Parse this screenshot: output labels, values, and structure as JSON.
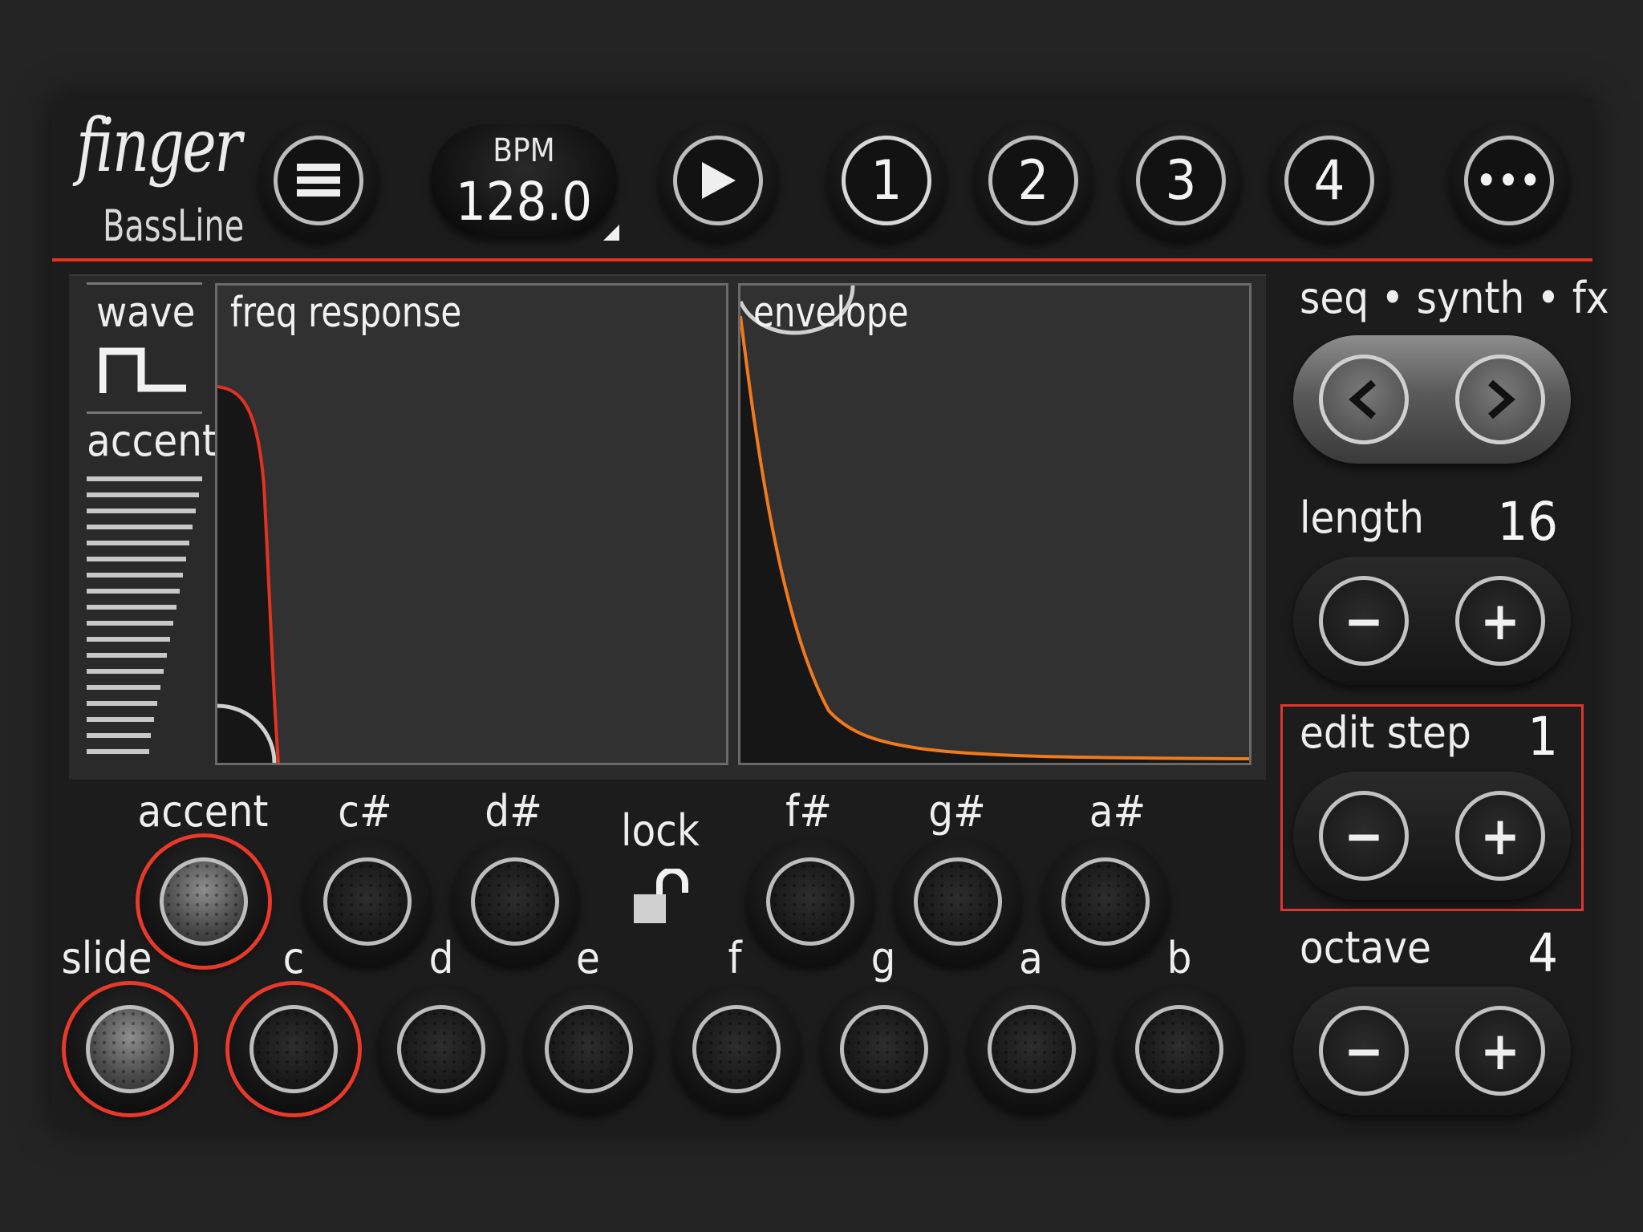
{
  "app": {
    "logo_top": "finger",
    "logo_bottom": "BassLine"
  },
  "header": {
    "bpm_label": "BPM",
    "bpm_value": "128.0",
    "patterns": [
      "1",
      "2",
      "3",
      "4"
    ],
    "active_pattern": "1",
    "more_label": "•••"
  },
  "display": {
    "wave_label": "wave",
    "wave_type": "square",
    "accent_label": "accent",
    "freq_response_title": "freq response",
    "envelope_title": "envelope"
  },
  "keyboard": {
    "accent_label": "accent",
    "slide_label": "slide",
    "lock_label": "lock",
    "black_keys": [
      "c#",
      "d#",
      "f#",
      "g#",
      "a#"
    ],
    "white_keys": [
      "c",
      "d",
      "e",
      "f",
      "g",
      "a",
      "b"
    ]
  },
  "controls": {
    "tabs_label": "seq • synth • fx",
    "length_label": "length",
    "length_value": "16",
    "edit_step_label": "edit step",
    "edit_step_value": "1",
    "octave_label": "octave",
    "octave_value": "4",
    "minus_label": "−",
    "plus_label": "+"
  },
  "colors": {
    "accent_red": "#e53322",
    "envelope_orange": "#f07a1c"
  }
}
